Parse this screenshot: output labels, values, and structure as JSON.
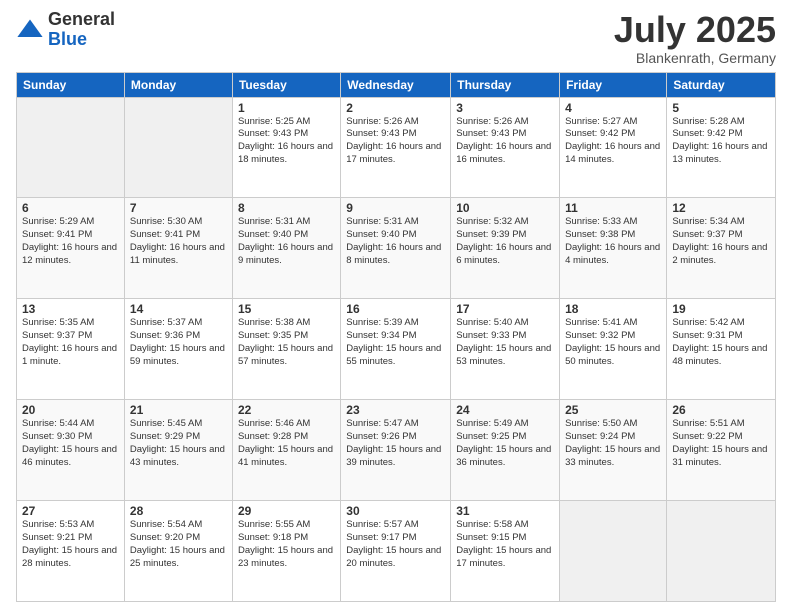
{
  "logo": {
    "general": "General",
    "blue": "Blue"
  },
  "title": "July 2025",
  "location": "Blankenrath, Germany",
  "days_of_week": [
    "Sunday",
    "Monday",
    "Tuesday",
    "Wednesday",
    "Thursday",
    "Friday",
    "Saturday"
  ],
  "weeks": [
    [
      {
        "day": "",
        "sunrise": "",
        "sunset": "",
        "daylight": ""
      },
      {
        "day": "",
        "sunrise": "",
        "sunset": "",
        "daylight": ""
      },
      {
        "day": "1",
        "sunrise": "Sunrise: 5:25 AM",
        "sunset": "Sunset: 9:43 PM",
        "daylight": "Daylight: 16 hours and 18 minutes."
      },
      {
        "day": "2",
        "sunrise": "Sunrise: 5:26 AM",
        "sunset": "Sunset: 9:43 PM",
        "daylight": "Daylight: 16 hours and 17 minutes."
      },
      {
        "day": "3",
        "sunrise": "Sunrise: 5:26 AM",
        "sunset": "Sunset: 9:43 PM",
        "daylight": "Daylight: 16 hours and 16 minutes."
      },
      {
        "day": "4",
        "sunrise": "Sunrise: 5:27 AM",
        "sunset": "Sunset: 9:42 PM",
        "daylight": "Daylight: 16 hours and 14 minutes."
      },
      {
        "day": "5",
        "sunrise": "Sunrise: 5:28 AM",
        "sunset": "Sunset: 9:42 PM",
        "daylight": "Daylight: 16 hours and 13 minutes."
      }
    ],
    [
      {
        "day": "6",
        "sunrise": "Sunrise: 5:29 AM",
        "sunset": "Sunset: 9:41 PM",
        "daylight": "Daylight: 16 hours and 12 minutes."
      },
      {
        "day": "7",
        "sunrise": "Sunrise: 5:30 AM",
        "sunset": "Sunset: 9:41 PM",
        "daylight": "Daylight: 16 hours and 11 minutes."
      },
      {
        "day": "8",
        "sunrise": "Sunrise: 5:31 AM",
        "sunset": "Sunset: 9:40 PM",
        "daylight": "Daylight: 16 hours and 9 minutes."
      },
      {
        "day": "9",
        "sunrise": "Sunrise: 5:31 AM",
        "sunset": "Sunset: 9:40 PM",
        "daylight": "Daylight: 16 hours and 8 minutes."
      },
      {
        "day": "10",
        "sunrise": "Sunrise: 5:32 AM",
        "sunset": "Sunset: 9:39 PM",
        "daylight": "Daylight: 16 hours and 6 minutes."
      },
      {
        "day": "11",
        "sunrise": "Sunrise: 5:33 AM",
        "sunset": "Sunset: 9:38 PM",
        "daylight": "Daylight: 16 hours and 4 minutes."
      },
      {
        "day": "12",
        "sunrise": "Sunrise: 5:34 AM",
        "sunset": "Sunset: 9:37 PM",
        "daylight": "Daylight: 16 hours and 2 minutes."
      }
    ],
    [
      {
        "day": "13",
        "sunrise": "Sunrise: 5:35 AM",
        "sunset": "Sunset: 9:37 PM",
        "daylight": "Daylight: 16 hours and 1 minute."
      },
      {
        "day": "14",
        "sunrise": "Sunrise: 5:37 AM",
        "sunset": "Sunset: 9:36 PM",
        "daylight": "Daylight: 15 hours and 59 minutes."
      },
      {
        "day": "15",
        "sunrise": "Sunrise: 5:38 AM",
        "sunset": "Sunset: 9:35 PM",
        "daylight": "Daylight: 15 hours and 57 minutes."
      },
      {
        "day": "16",
        "sunrise": "Sunrise: 5:39 AM",
        "sunset": "Sunset: 9:34 PM",
        "daylight": "Daylight: 15 hours and 55 minutes."
      },
      {
        "day": "17",
        "sunrise": "Sunrise: 5:40 AM",
        "sunset": "Sunset: 9:33 PM",
        "daylight": "Daylight: 15 hours and 53 minutes."
      },
      {
        "day": "18",
        "sunrise": "Sunrise: 5:41 AM",
        "sunset": "Sunset: 9:32 PM",
        "daylight": "Daylight: 15 hours and 50 minutes."
      },
      {
        "day": "19",
        "sunrise": "Sunrise: 5:42 AM",
        "sunset": "Sunset: 9:31 PM",
        "daylight": "Daylight: 15 hours and 48 minutes."
      }
    ],
    [
      {
        "day": "20",
        "sunrise": "Sunrise: 5:44 AM",
        "sunset": "Sunset: 9:30 PM",
        "daylight": "Daylight: 15 hours and 46 minutes."
      },
      {
        "day": "21",
        "sunrise": "Sunrise: 5:45 AM",
        "sunset": "Sunset: 9:29 PM",
        "daylight": "Daylight: 15 hours and 43 minutes."
      },
      {
        "day": "22",
        "sunrise": "Sunrise: 5:46 AM",
        "sunset": "Sunset: 9:28 PM",
        "daylight": "Daylight: 15 hours and 41 minutes."
      },
      {
        "day": "23",
        "sunrise": "Sunrise: 5:47 AM",
        "sunset": "Sunset: 9:26 PM",
        "daylight": "Daylight: 15 hours and 39 minutes."
      },
      {
        "day": "24",
        "sunrise": "Sunrise: 5:49 AM",
        "sunset": "Sunset: 9:25 PM",
        "daylight": "Daylight: 15 hours and 36 minutes."
      },
      {
        "day": "25",
        "sunrise": "Sunrise: 5:50 AM",
        "sunset": "Sunset: 9:24 PM",
        "daylight": "Daylight: 15 hours and 33 minutes."
      },
      {
        "day": "26",
        "sunrise": "Sunrise: 5:51 AM",
        "sunset": "Sunset: 9:22 PM",
        "daylight": "Daylight: 15 hours and 31 minutes."
      }
    ],
    [
      {
        "day": "27",
        "sunrise": "Sunrise: 5:53 AM",
        "sunset": "Sunset: 9:21 PM",
        "daylight": "Daylight: 15 hours and 28 minutes."
      },
      {
        "day": "28",
        "sunrise": "Sunrise: 5:54 AM",
        "sunset": "Sunset: 9:20 PM",
        "daylight": "Daylight: 15 hours and 25 minutes."
      },
      {
        "day": "29",
        "sunrise": "Sunrise: 5:55 AM",
        "sunset": "Sunset: 9:18 PM",
        "daylight": "Daylight: 15 hours and 23 minutes."
      },
      {
        "day": "30",
        "sunrise": "Sunrise: 5:57 AM",
        "sunset": "Sunset: 9:17 PM",
        "daylight": "Daylight: 15 hours and 20 minutes."
      },
      {
        "day": "31",
        "sunrise": "Sunrise: 5:58 AM",
        "sunset": "Sunset: 9:15 PM",
        "daylight": "Daylight: 15 hours and 17 minutes."
      },
      {
        "day": "",
        "sunrise": "",
        "sunset": "",
        "daylight": ""
      },
      {
        "day": "",
        "sunrise": "",
        "sunset": "",
        "daylight": ""
      }
    ]
  ]
}
